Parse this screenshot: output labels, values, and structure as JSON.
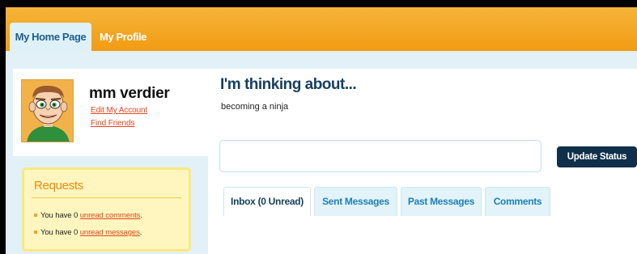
{
  "tabs": {
    "home": "My Home Page",
    "profile": "My Profile"
  },
  "profile": {
    "name": "mm verdier",
    "edit_account": "Edit My Account",
    "find_friends": "Find Friends"
  },
  "requests": {
    "title": "Requests",
    "items": [
      {
        "prefix": "You have 0 ",
        "link": "unread comments",
        "suffix": "."
      },
      {
        "prefix": "You have 0 ",
        "link": "unread messages",
        "suffix": "."
      }
    ]
  },
  "status": {
    "title": "I'm thinking about...",
    "current": "becoming a ninja",
    "input_value": "",
    "update_button": "Update Status"
  },
  "messages": {
    "tabs": [
      "Inbox (0 Unread)",
      "Sent Messages",
      "Past Messages",
      "Comments"
    ]
  },
  "colors": {
    "topbar": "#f19b12",
    "accent_link": "#e1461e",
    "button": "#0f2f4a",
    "page_bg": "#e1f1f7"
  },
  "icons": [
    "avatar-cartoon-face"
  ]
}
